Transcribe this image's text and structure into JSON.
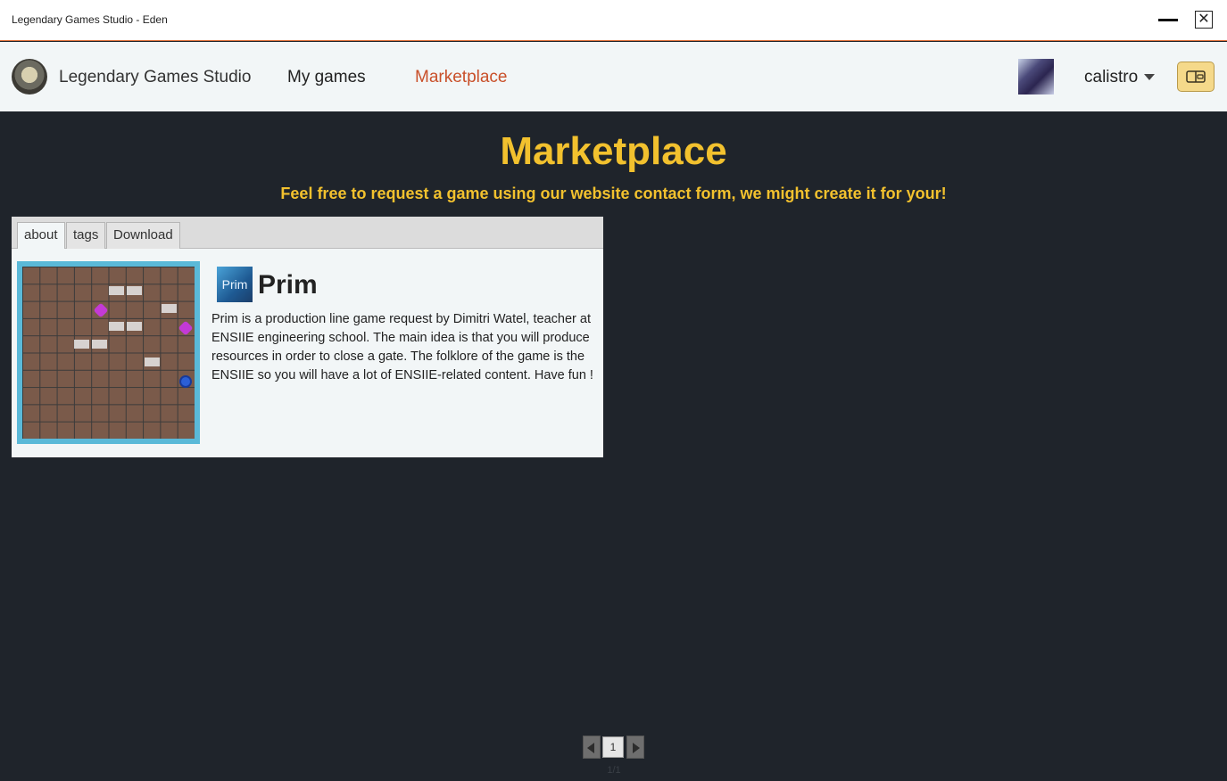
{
  "window": {
    "title": "Legendary Games Studio - Eden",
    "minimize_icon": "minimize-icon",
    "close_icon": "close-icon",
    "close_glyph": "✕"
  },
  "navbar": {
    "studio_name": "Legendary Games Studio",
    "nav_items": [
      "My games",
      "Marketplace"
    ],
    "active_item": "Marketplace",
    "username": "calistro",
    "wallet_icon": "wallet-icon",
    "active_color": "#c9502a",
    "accent_color": "#f5d98a"
  },
  "page": {
    "title": "Marketplace",
    "subtitle": "Feel free to request a game using our website contact form, we might create it for your!",
    "title_color": "#f2c12e"
  },
  "game_card": {
    "tabs": [
      "about",
      "tags",
      "Download"
    ],
    "active_tab": "about",
    "icon_text": "Prim",
    "name": "Prim",
    "description": "Prim is a production line game request by Dimitri Watel, teacher at ENSIIE engineering school. The main idea is that you will produce resources in order to close a gate. The folklore of  the game is the ENSIIE so you will have a lot of ENSIIE-related content. Have fun !"
  },
  "pagination": {
    "current_page": "1",
    "page_count_label": "1/1",
    "prev_icon": "triangle-left-icon",
    "next_icon": "triangle-right-icon"
  }
}
